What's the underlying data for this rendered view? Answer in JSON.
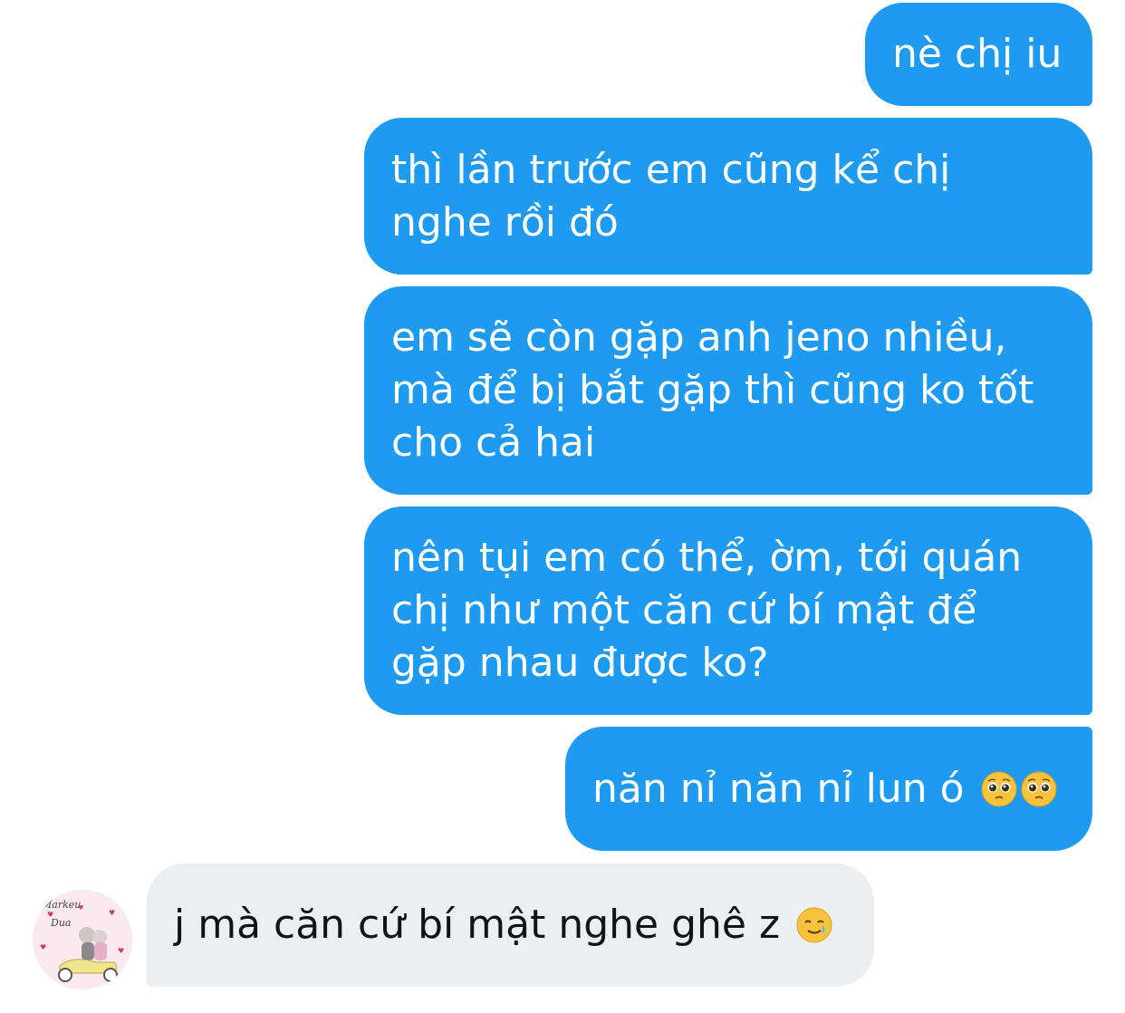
{
  "messages": [
    {
      "id": "b1",
      "direction": "outgoing",
      "lines": [
        "nè chị iu"
      ]
    },
    {
      "id": "b2",
      "direction": "outgoing",
      "lines": [
        "thì lần trước em cũng kể chị",
        "nghe rồi đó"
      ]
    },
    {
      "id": "b3",
      "direction": "outgoing",
      "lines": [
        "em sẽ còn gặp anh jeno nhiều,",
        "mà để bị bắt gặp thì cũng ko tốt",
        "cho cả hai"
      ]
    },
    {
      "id": "b4",
      "direction": "outgoing",
      "lines": [
        "nên tụi em có thể, ờm, tới quán",
        "chị như một căn cứ bí mật để",
        "gặp nhau được ko?"
      ]
    },
    {
      "id": "b5",
      "direction": "outgoing",
      "text": "năn nỉ năn nỉ lun ó",
      "emojis": [
        "pleading-face",
        "pleading-face"
      ]
    },
    {
      "id": "b6",
      "direction": "incoming",
      "text": "j mà căn cứ bí mật nghe ghê z",
      "emojis": [
        "smiling-face-with-tear"
      ]
    }
  ],
  "avatar": {
    "line1": "Markeu",
    "line2": "Dua"
  },
  "colors": {
    "outgoing_bubble": "#1e9bf0",
    "incoming_bubble": "#eceff2",
    "outgoing_text": "#ffffff",
    "incoming_text": "#0f1419"
  }
}
